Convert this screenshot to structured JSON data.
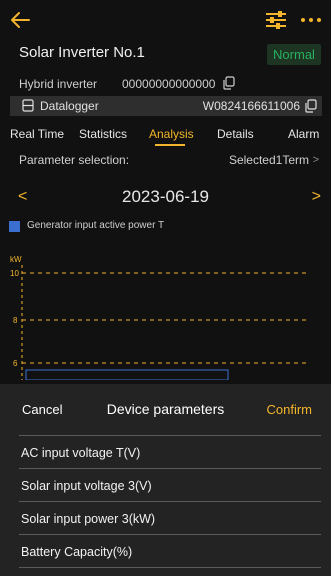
{
  "header": {
    "back_icon": "back-arrow-icon",
    "filter_icon": "sliders-icon",
    "more_icon": "more-dots-icon",
    "accent": "#f3b52c"
  },
  "device": {
    "title": "Solar Inverter No.1",
    "status": "Normal",
    "status_color": "#27b05d",
    "type": "Hybrid inverter",
    "serial": "00000000000000",
    "logger_label": "Datalogger",
    "logger_id": "W0824166611006"
  },
  "tabs": [
    {
      "label": "Real Time"
    },
    {
      "label": "Statistics"
    },
    {
      "label": "Analysis"
    },
    {
      "label": "Details"
    },
    {
      "label": "Alarm"
    }
  ],
  "active_tab": "Analysis",
  "param": {
    "label": "Parameter selection:",
    "value": "Selected1Term",
    "chevron": ">"
  },
  "date": {
    "prev": "<",
    "value": "2023-06-19",
    "next": ">"
  },
  "legend": {
    "label": "Generator input active power T",
    "color": "#3a6fd0"
  },
  "chart": {
    "unit": "kW",
    "ticks": [
      "10",
      "8",
      "6"
    ]
  },
  "sheet": {
    "cancel": "Cancel",
    "title": "Device parameters",
    "confirm": "Confirm",
    "options": [
      {
        "label": "AC input voltage T(V)"
      },
      {
        "label": "Solar input voltage 3(V)"
      },
      {
        "label": "Solar input power 3(kW)"
      },
      {
        "label": "Battery Capacity(%)"
      }
    ]
  }
}
